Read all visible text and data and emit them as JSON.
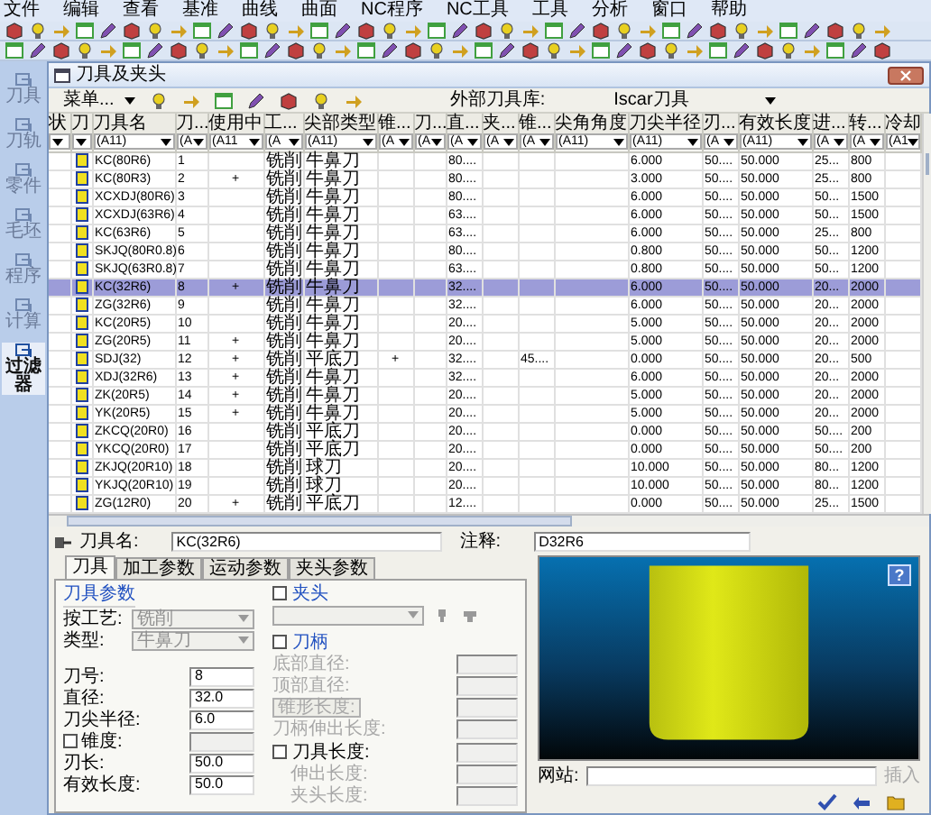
{
  "menu_bar": [
    "文件",
    "编辑",
    "查看",
    "基准",
    "曲线",
    "曲面",
    "NC程序",
    "NC工具",
    "工具",
    "分析",
    "窗口",
    "帮助"
  ],
  "sidebar": {
    "items": [
      {
        "label": "刀具",
        "selected": false
      },
      {
        "label": "刀轨",
        "selected": false
      },
      {
        "label": "零件",
        "selected": false
      },
      {
        "label": "毛坯",
        "selected": false
      },
      {
        "label": "程序",
        "selected": false
      },
      {
        "label": "计算",
        "selected": false
      },
      {
        "label": "过滤器",
        "selected": true
      }
    ]
  },
  "dialog": {
    "title": "刀具及夹头",
    "toolbar": {
      "menu_button": "菜单...",
      "library_label": "外部刀具库:",
      "library_value": "Iscar刀具"
    },
    "table": {
      "columns": [
        {
          "label": "状"
        },
        {
          "label": "刀"
        },
        {
          "label": "刀具名",
          "filter": "(A11)"
        },
        {
          "label": "刀...",
          "filter": "(A"
        },
        {
          "label": "使用中",
          "filter": "(A11"
        },
        {
          "label": "工...",
          "filter": "(A"
        },
        {
          "label": "尖部类型",
          "filter": "(A11)"
        },
        {
          "label": "锥...",
          "filter": "(A"
        },
        {
          "label": "刀...",
          "filter": "(A"
        },
        {
          "label": "直...",
          "filter": "(A"
        },
        {
          "label": "夹...",
          "filter": "(A"
        },
        {
          "label": "锥...",
          "filter": "(A"
        },
        {
          "label": "尖角角度",
          "filter": "(A11)"
        },
        {
          "label": "刀尖半径",
          "filter": "(A11)"
        },
        {
          "label": "刃...",
          "filter": "(A"
        },
        {
          "label": "有效长度",
          "filter": "(A11)"
        },
        {
          "label": "进...",
          "filter": "(A"
        },
        {
          "label": "转...",
          "filter": "(A"
        },
        {
          "label": "冷却",
          "filter": "(A1"
        }
      ],
      "rows": [
        {
          "selected": false,
          "name": "KC(80R6)",
          "number": "1",
          "process": "铣削",
          "tip_type": "牛鼻刀",
          "diameter": "80....",
          "tip_radius": "6.000",
          "edge": "50....",
          "effective": "50.000",
          "feed": "25...",
          "speed": "800"
        },
        {
          "selected": false,
          "name": "KC(80R3)",
          "number": "2",
          "in_use": "+",
          "process": "铣削",
          "tip_type": "牛鼻刀",
          "diameter": "80....",
          "tip_radius": "3.000",
          "edge": "50....",
          "effective": "50.000",
          "feed": "25...",
          "speed": "800"
        },
        {
          "selected": false,
          "name": "XCXDJ(80R6)",
          "number": "3",
          "process": "铣削",
          "tip_type": "牛鼻刀",
          "diameter": "80....",
          "tip_radius": "6.000",
          "edge": "50....",
          "effective": "50.000",
          "feed": "50...",
          "speed": "1500"
        },
        {
          "selected": false,
          "name": "XCXDJ(63R6)",
          "number": "4",
          "process": "铣削",
          "tip_type": "牛鼻刀",
          "diameter": "63....",
          "tip_radius": "6.000",
          "edge": "50....",
          "effective": "50.000",
          "feed": "50...",
          "speed": "1500"
        },
        {
          "selected": false,
          "name": "KC(63R6)",
          "number": "5",
          "process": "铣削",
          "tip_type": "牛鼻刀",
          "diameter": "63....",
          "tip_radius": "6.000",
          "edge": "50....",
          "effective": "50.000",
          "feed": "25...",
          "speed": "800"
        },
        {
          "selected": false,
          "name": "SKJQ(80R0.8)",
          "number": "6",
          "process": "铣削",
          "tip_type": "牛鼻刀",
          "diameter": "80....",
          "tip_radius": "0.800",
          "edge": "50....",
          "effective": "50.000",
          "feed": "50...",
          "speed": "1200"
        },
        {
          "selected": false,
          "name": "SKJQ(63R0.8)",
          "number": "7",
          "process": "铣削",
          "tip_type": "牛鼻刀",
          "diameter": "63....",
          "tip_radius": "0.800",
          "edge": "50....",
          "effective": "50.000",
          "feed": "50...",
          "speed": "1200"
        },
        {
          "selected": true,
          "name": "KC(32R6)",
          "number": "8",
          "in_use": "+",
          "process": "铣削",
          "tip_type": "牛鼻刀",
          "diameter": "32....",
          "tip_radius": "6.000",
          "edge": "50....",
          "effective": "50.000",
          "feed": "20...",
          "speed": "2000"
        },
        {
          "selected": false,
          "name": "ZG(32R6)",
          "number": "9",
          "process": "铣削",
          "tip_type": "牛鼻刀",
          "diameter": "32....",
          "tip_radius": "6.000",
          "edge": "50....",
          "effective": "50.000",
          "feed": "20...",
          "speed": "2000"
        },
        {
          "selected": false,
          "name": "KC(20R5)",
          "number": "10",
          "process": "铣削",
          "tip_type": "牛鼻刀",
          "diameter": "20....",
          "tip_radius": "5.000",
          "edge": "50....",
          "effective": "50.000",
          "feed": "20...",
          "speed": "2000"
        },
        {
          "selected": false,
          "name": "ZG(20R5)",
          "number": "11",
          "in_use": "+",
          "process": "铣削",
          "tip_type": "牛鼻刀",
          "diameter": "20....",
          "tip_radius": "5.000",
          "edge": "50....",
          "effective": "50.000",
          "feed": "20...",
          "speed": "2000"
        },
        {
          "selected": false,
          "name": "SDJ(32)",
          "number": "12",
          "in_use": "+",
          "process": "铣削",
          "tip_type": "平底刀",
          "taper": "+",
          "diameter": "32....",
          "cone": "45....",
          "tip_radius": "0.000",
          "edge": "50....",
          "effective": "50.000",
          "feed": "20...",
          "speed": "500"
        },
        {
          "selected": false,
          "name": "XDJ(32R6)",
          "number": "13",
          "in_use": "+",
          "process": "铣削",
          "tip_type": "牛鼻刀",
          "diameter": "32....",
          "tip_radius": "6.000",
          "edge": "50....",
          "effective": "50.000",
          "feed": "20...",
          "speed": "2000"
        },
        {
          "selected": false,
          "name": "ZK(20R5)",
          "number": "14",
          "in_use": "+",
          "process": "铣削",
          "tip_type": "牛鼻刀",
          "diameter": "20....",
          "tip_radius": "5.000",
          "edge": "50....",
          "effective": "50.000",
          "feed": "20...",
          "speed": "2000"
        },
        {
          "selected": false,
          "name": "YK(20R5)",
          "number": "15",
          "in_use": "+",
          "process": "铣削",
          "tip_type": "牛鼻刀",
          "diameter": "20....",
          "tip_radius": "5.000",
          "edge": "50....",
          "effective": "50.000",
          "feed": "20...",
          "speed": "2000"
        },
        {
          "selected": false,
          "name": "ZKCQ(20R0)",
          "number": "16",
          "process": "铣削",
          "tip_type": "平底刀",
          "diameter": "20....",
          "tip_radius": "0.000",
          "edge": "50....",
          "effective": "50.000",
          "feed": "50....",
          "speed": "200"
        },
        {
          "selected": false,
          "name": "YKCQ(20R0)",
          "number": "17",
          "process": "铣削",
          "tip_type": "平底刀",
          "diameter": "20....",
          "tip_radius": "0.000",
          "edge": "50....",
          "effective": "50.000",
          "feed": "50....",
          "speed": "200"
        },
        {
          "selected": false,
          "name": "ZKJQ(20R10)",
          "number": "18",
          "process": "铣削",
          "tip_type": "球刀",
          "diameter": "20....",
          "tip_radius": "10.000",
          "edge": "50....",
          "effective": "50.000",
          "feed": "80...",
          "speed": "1200"
        },
        {
          "selected": false,
          "name": "YKJQ(20R10)",
          "number": "19",
          "process": "铣削",
          "tip_type": "球刀",
          "diameter": "20....",
          "tip_radius": "10.000",
          "edge": "50....",
          "effective": "50.000",
          "feed": "80...",
          "speed": "1200"
        },
        {
          "selected": false,
          "name": "ZG(12R0)",
          "number": "20",
          "in_use": "+",
          "process": "铣削",
          "tip_type": "平底刀",
          "diameter": "12....",
          "tip_radius": "0.000",
          "edge": "50....",
          "effective": "50.000",
          "feed": "25...",
          "speed": "1500"
        }
      ]
    },
    "detail": {
      "name_label": "刀具名:",
      "name_value": "KC(32R6)",
      "comment_label": "注释:",
      "comment_value": "D32R6",
      "tabs": [
        {
          "label": "刀具",
          "selected": true
        },
        {
          "label": "加工参数",
          "selected": false
        },
        {
          "label": "运动参数",
          "selected": false
        },
        {
          "label": "夹头参数",
          "selected": false
        }
      ],
      "tool_params": {
        "title": "刀具参数",
        "rows": [
          {
            "kind": "select",
            "label": "按工艺:",
            "value": "铣削",
            "disabled": true
          },
          {
            "kind": "select",
            "label": "类型:",
            "value": "牛鼻刀",
            "disabled": true
          },
          {
            "kind": "input",
            "label": "刀号:",
            "value": "8"
          },
          {
            "kind": "input",
            "label": "直径:",
            "value": "32.0"
          },
          {
            "kind": "input",
            "label": "刀尖半径:",
            "value": "6.0"
          },
          {
            "kind": "check_input",
            "label": "锥度:",
            "checked": false
          },
          {
            "kind": "input",
            "label": "刃长:",
            "value": "50.0"
          },
          {
            "kind": "input",
            "label": "有效长度:",
            "value": "50.0"
          }
        ]
      },
      "chuck": {
        "label": "夹头",
        "checked": false
      },
      "shank": {
        "label": "刀柄",
        "checked": false,
        "rows": [
          {
            "kind": "input",
            "label": "底部直径:"
          },
          {
            "kind": "input",
            "label": "顶部直径:"
          },
          {
            "kind": "button",
            "label": "锥形长度:"
          },
          {
            "kind": "input",
            "label": "刀柄伸出长度:"
          }
        ]
      },
      "tool_length": {
        "label": "刀具长度:",
        "checked": false,
        "rows": [
          {
            "kind": "input",
            "label": "伸出长度:"
          },
          {
            "kind": "input",
            "label": "夹头长度:"
          }
        ]
      },
      "help_label": "?",
      "website_label": "网站:",
      "insert_label": "插入"
    }
  }
}
